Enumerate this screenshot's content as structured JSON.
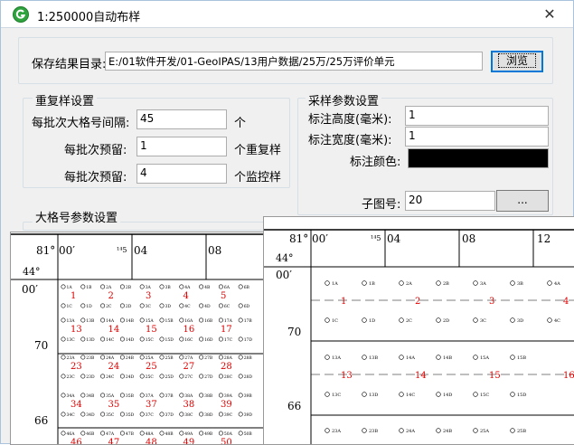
{
  "window": {
    "title": "1:250000自动布样",
    "close_label": "✕"
  },
  "output_dir": {
    "label": "保存结果目录:",
    "value": "E:/01软件开发/01-GeoIPAS/13用户数据/25万/25万评价单元",
    "browse_label": "浏览"
  },
  "resample": {
    "legend": "重复样设置",
    "interval_label": "每批次大格号间隔:",
    "interval_value": "45",
    "interval_unit": "个",
    "reserve_label_1": "每批次预留:",
    "reserve_value_1": "1",
    "reserve_unit_1": "个重复样",
    "reserve_label_2": "每批次预留:",
    "reserve_value_2": "4",
    "reserve_unit_2": "个监控样"
  },
  "sampling": {
    "legend": "采样参数设置",
    "height_label": "标注高度(毫米):",
    "height_value": "1",
    "width_label": "标注宽度(毫米):",
    "width_value": "1",
    "color_label": "标注颜色:",
    "color_value": "#000000",
    "subfig_label": "子图号:",
    "subfig_value": "20",
    "more_label": "..."
  },
  "bigcell": {
    "legend": "大格号参数设置"
  },
  "map_left": {
    "lon_labels": [
      "81°",
      "00′",
      "04",
      "08"
    ],
    "lon_prefix": "¹⁴5",
    "lat_labels": [
      "44°",
      "00′",
      "70",
      "66"
    ],
    "cells": [
      {
        "sub": [
          "1A",
          "1B",
          "2A",
          "2B",
          "3A",
          "3B",
          "4A",
          "4B",
          "6A",
          "6B"
        ],
        "nums": [
          "1",
          "2",
          "3",
          "4",
          "5"
        ],
        "sub2": [
          "1C",
          "1D",
          "2C",
          "2D",
          "3C",
          "3D",
          "4C",
          "4D",
          "6C",
          "6D"
        ]
      },
      {
        "sub": [
          "13A",
          "13B",
          "14A",
          "14B",
          "15A",
          "15B",
          "16A",
          "16B",
          "17A",
          "17B"
        ],
        "nums": [
          "13",
          "14",
          "15",
          "16",
          "17"
        ],
        "sub2": [
          "13C",
          "13D",
          "14C",
          "14D",
          "15C",
          "15D",
          "16C",
          "16D",
          "17C",
          "17D"
        ]
      },
      {
        "sub": [
          "23A",
          "23B",
          "24A",
          "24B",
          "25A",
          "25B",
          "27A",
          "27B",
          "28A",
          "28B"
        ],
        "nums": [
          "23",
          "24",
          "25",
          "27",
          "28"
        ],
        "sub2": [
          "23C",
          "23D",
          "24C",
          "24D",
          "25C",
          "25D",
          "27C",
          "27D",
          "28C",
          "28D"
        ]
      },
      {
        "sub": [
          "34A",
          "34B",
          "35A",
          "35B",
          "37A",
          "37B",
          "38A",
          "38B",
          "39A",
          "39B"
        ],
        "nums": [
          "34",
          "35",
          "37",
          "38",
          "39"
        ],
        "sub2": [
          "34C",
          "34D",
          "35C",
          "35D",
          "37C",
          "37D",
          "38C",
          "38D",
          "39C",
          "39D"
        ]
      },
      {
        "sub": [
          "46A",
          "46B",
          "47A",
          "47B",
          "48A",
          "48B",
          "49A",
          "49B",
          "50A",
          "50B"
        ],
        "nums": [
          "46",
          "47",
          "48",
          "49",
          "50"
        ],
        "sub2": []
      }
    ]
  },
  "map_right": {
    "lon_labels": [
      "81°",
      "00′",
      "04",
      "08",
      "12"
    ],
    "lon_prefix": "¹⁴5",
    "lat_labels": [
      "44°",
      "00′",
      "70",
      "66"
    ],
    "row1_sub": [
      "1A",
      "1B",
      "2A",
      "2B",
      "3A",
      "3B",
      "4A"
    ],
    "row1_nums": [
      "1",
      "2",
      "3",
      "4"
    ],
    "row1_sub2": [
      "1C",
      "1D",
      "2C",
      "2D",
      "3C",
      "3D",
      "4C"
    ],
    "row2_sub": [
      "13A",
      "13B",
      "14A",
      "14B",
      "15A",
      "15B"
    ],
    "row2_nums": [
      "13",
      "14",
      "15",
      "16"
    ],
    "row2_sub2": [
      "13C",
      "13D",
      "14C",
      "14D",
      "15C",
      "15D"
    ],
    "row3_sub": [
      "23A",
      "23B",
      "24A",
      "24B",
      "25A",
      "25B"
    ]
  },
  "colors": {
    "sample_red": "#e00000",
    "title_bg": "#ffffff",
    "dialog_bg": "#f0f0f0"
  }
}
